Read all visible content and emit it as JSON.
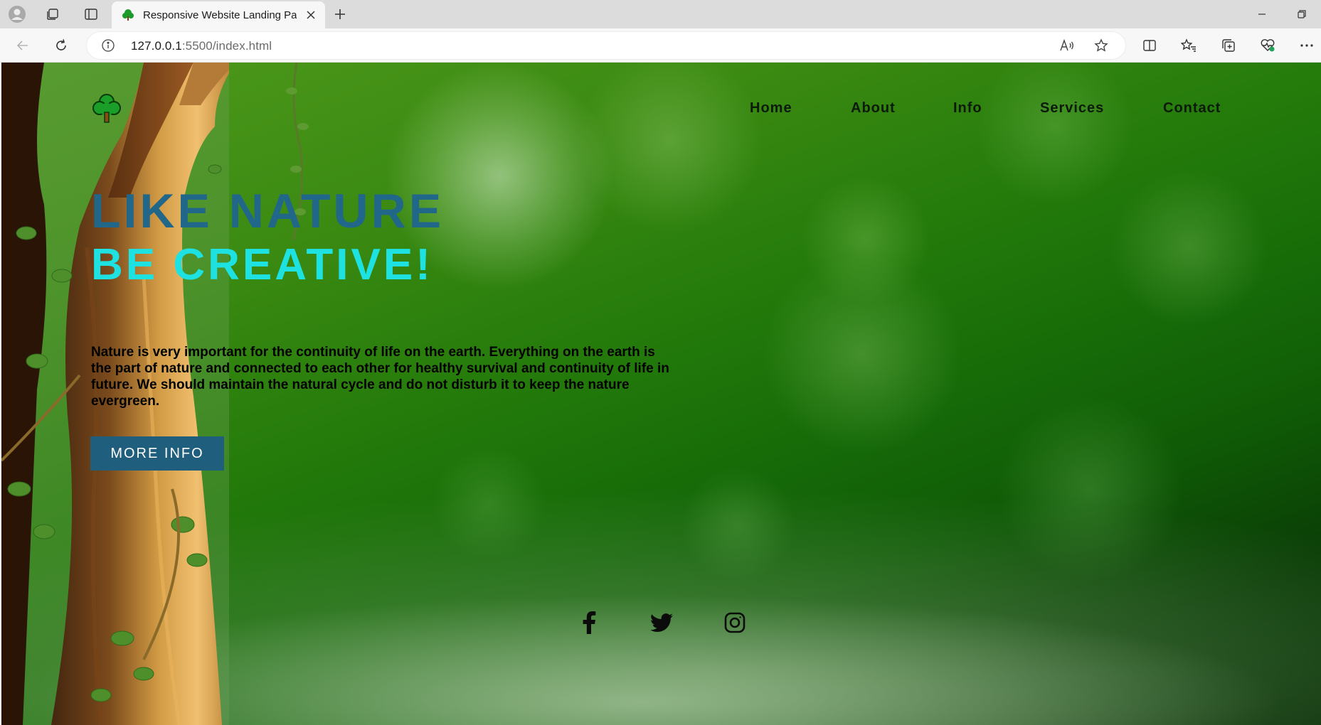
{
  "browser": {
    "tab_title": "Responsive Website Landing Page",
    "url_host": "127.0.0.1",
    "url_path": ":5500/index.html",
    "icons": [
      "profile-icon",
      "workspaces-icon",
      "tab-actions-icon",
      "tree-favicon",
      "close-icon",
      "new-tab-icon",
      "minimize-icon",
      "restore-icon",
      "back-icon",
      "refresh-icon",
      "info-icon",
      "read-aloud-icon",
      "favorite-star-icon",
      "split-screen-icon",
      "favorites-icon",
      "collections-icon",
      "performance-icon",
      "more-icon"
    ]
  },
  "page": {
    "nav": {
      "items": [
        {
          "label": "Home"
        },
        {
          "label": "About"
        },
        {
          "label": "Info"
        },
        {
          "label": "Services"
        },
        {
          "label": "Contact"
        }
      ]
    },
    "hero": {
      "line1": "LIKE NATURE",
      "line2": "BE CREATIVE!",
      "description": "Nature is very important for the continuity of life on the earth. Everything on the earth is the part of nature and connected to each other for healthy survival and continuity of life in future. We should maintain the natural cycle and do not disturb it to keep the nature evergreen.",
      "cta_label": "MORE INFO"
    },
    "social": [
      "facebook-icon",
      "twitter-icon",
      "instagram-icon"
    ],
    "colors": {
      "headline1": "#21678a",
      "headline2": "#1ee2e2",
      "button": "#1f5e7d"
    }
  }
}
